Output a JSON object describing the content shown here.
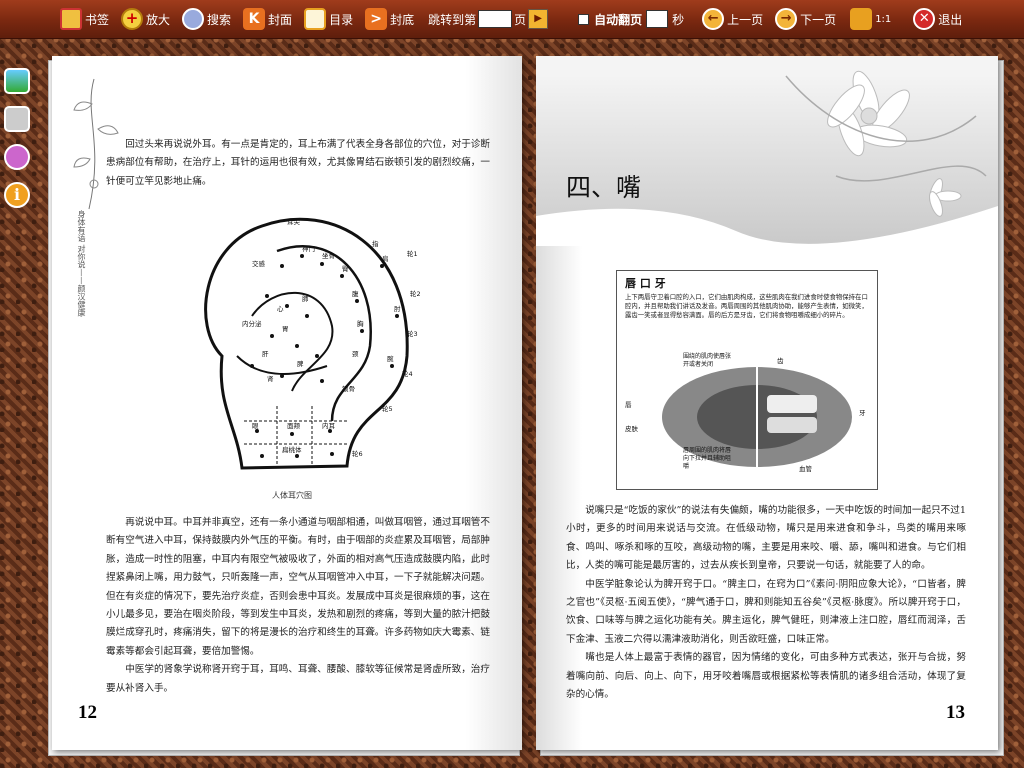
{
  "toolbar": {
    "bookmark": "书签",
    "zoom": "放大",
    "search": "搜索",
    "cover": "封面",
    "toc": "目录",
    "back_cover": "封底",
    "jump_prefix": "跳转到第",
    "jump_suffix": "页",
    "jump_value": "",
    "auto_flip": "自动翻页",
    "seconds": "秒",
    "prev": "上一页",
    "next": "下一页",
    "ratio": "1:1",
    "exit": "退出"
  },
  "left_page": {
    "header_vertical": "身体有语 对你说——颜汉健康",
    "para1": "回过头来再说说外耳。有一点是肯定的，耳上布满了代表全身各部位的穴位，对于诊断患病部位有帮助，在治疗上，耳针的运用也很有效，尤其像胃结石嵌顿引发的剧烈绞痛，一针便可立竿见影地止痛。",
    "figure_caption": "人体耳穴图",
    "ear_labels": [
      "耳尖",
      "交感",
      "神门",
      "坐骨",
      "臀",
      "腹",
      "胸",
      "颈",
      "肩",
      "肘",
      "腕",
      "指",
      "锁骨",
      "胃",
      "肝",
      "脾",
      "肾",
      "心",
      "肺",
      "内分泌",
      "眼",
      "面颊",
      "内耳",
      "扁桃体",
      "轮1",
      "轮2",
      "轮3",
      "轮4",
      "轮5",
      "轮6"
    ],
    "para2": "再说说中耳。中耳并非真空，还有一条小通道与咽部相通，叫做耳咽管，通过耳咽管不断有空气进入中耳，保持鼓膜内外气压的平衡。有时，由于咽部的炎症累及耳咽管，局部肿胀，造成一时性的阻塞，中耳内有限空气被吸收了，外面的相对高气压造成鼓膜内陷，此时捏紧鼻闭上嘴，用力鼓气，只听轰隆一声，空气从耳咽管冲入中耳，一下子就能解决问题。但在有炎症的情况下，要先治疗炎症，否则会患中耳炎。发展成中耳炎是很麻烦的事，这在小儿最多见，要治在咽炎阶段，等到发生中耳炎，发热和剧烈的疼痛，等到大量的脓汁把鼓膜烂成穿孔时，疼痛消失，留下的将是漫长的治疗和终生的耳聋。许多药物如庆大霉素、链霉素等都会引起耳聋，要倍加警惕。",
    "para3": "中医学的肾象学说称肾开窍于耳，耳鸣、耳聋、腰酸、膝软等征候常是肾虚所致，治疗要从补肾入手。",
    "page_number": "12"
  },
  "right_page": {
    "chapter_title": "四、嘴",
    "figure_title": "唇 口 牙",
    "figure_desc": "上下两唇守卫着口腔的入口，它们由肌肉构成，这些肌肉在我们进食时使食物保持在口腔内，并且帮助我们讲话及发音。两唇周围的其他肌肉协助，能够产生表情，如微笑，露齿一笑或者显得愁容满面。唇的后方是牙齿，它们将食物咀嚼成细小的碎片。",
    "fig_labels": {
      "top_left": "围绕的肌肉使唇张开或者关闭",
      "top_right": "齿",
      "left1": "唇",
      "left2": "皮肤",
      "right1": "牙",
      "bottom_left": "唇周围的肌肉将唇向下拉并且辅助咀嚼",
      "bottom_right": "血管"
    },
    "para1": "说嘴只是“吃饭的家伙”的说法有失偏颇，嘴的功能很多，一天中吃饭的时间加一起只不过1小时，更多的时间用来说话与交流。在低级动物，嘴只是用来进食和争斗，鸟类的嘴用来啄食、鸣叫、啄杀和啄的互咬，高级动物的嘴，主要是用来咬、嚼、舔，嘴叫和进食。与它们相比，人类的嘴可能是最厉害的，过去从疾长到皇帝，只要说一句话，就能要了人的命。",
    "para2": "中医学脏象论认为脾开窍于口。“脾主口，在窍为口”《素问·阴阳应象大论》，“口皆者，脾之官也”《灵枢·五阅五使》，“脾气通于口，脾和则能知五谷矣”《灵枢·脉度》。所以脾开窍于口，饮食、口味等与脾之运化功能有关。脾主运化，脾气健旺，则津液上注口腔，唇红而润泽，舌下金津、玉液二穴得以濡津液助消化，则舌欲旺盛，口味正常。",
    "para3": "嘴也是人体上最富于表情的器官，因为情绪的变化，可由多种方式表达，张开与合拢，努着嘴向前、向后、向上、向下，用牙咬着嘴唇或根据紧松等表情肌的诸多组合活动，体现了复杂的心情。",
    "page_number": "13"
  }
}
